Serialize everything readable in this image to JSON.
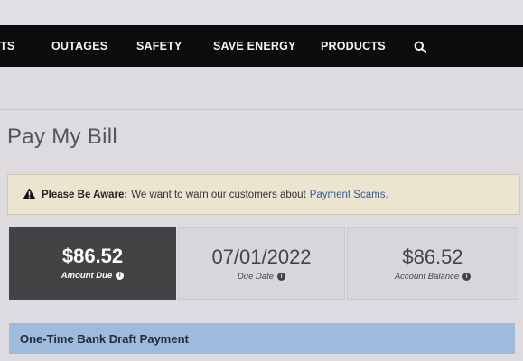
{
  "nav": {
    "items": [
      {
        "label": "TS"
      },
      {
        "label": "OUTAGES"
      },
      {
        "label": "SAFETY"
      },
      {
        "label": "SAVE ENERGY"
      },
      {
        "label": "PRODUCTS"
      }
    ],
    "search_icon": "search-icon"
  },
  "page": {
    "title": "Pay My Bill"
  },
  "alert": {
    "icon": "warning-icon",
    "strong": "Please Be Aware:",
    "message": "We want to warn our customers about",
    "link": "Payment Scams",
    "period": "."
  },
  "summary": {
    "amount_due": {
      "value": "$86.52",
      "label": "Amount Due",
      "icon": "info-icon"
    },
    "due_date": {
      "value": "07/01/2022",
      "label": "Due Date",
      "icon": "info-icon"
    },
    "account_balance": {
      "value": "$86.52",
      "label": "Account Balance",
      "icon": "info-icon"
    }
  },
  "payment": {
    "section_title": "One-Time Bank Draft Payment"
  },
  "colors": {
    "nav_bg": "#0c0c0e",
    "amount_card_bg": "#434345",
    "alert_bg": "#ebe4cf",
    "link": "#3d5a92",
    "section_bar": "#9ebbde"
  }
}
